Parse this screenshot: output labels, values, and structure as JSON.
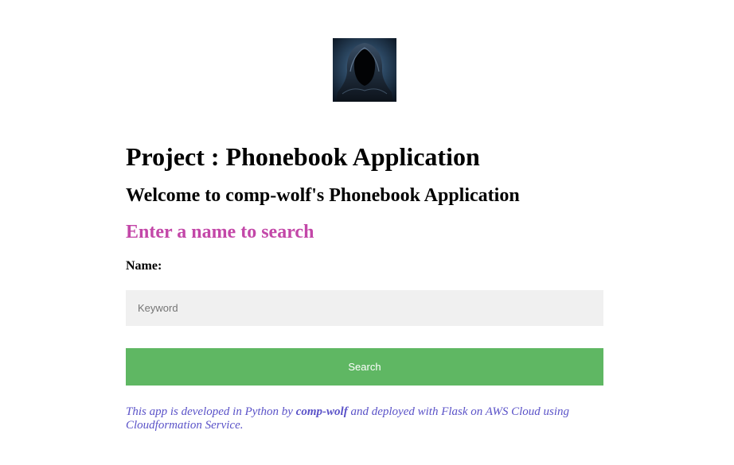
{
  "colors": {
    "heading_accent": "#c347a8",
    "button_bg": "#5fb763",
    "button_text": "#ffffff",
    "input_bg": "#f0f0f0",
    "footer_text": "#5a52c8"
  },
  "logo": {
    "icon": "hooded-figure-avatar"
  },
  "page": {
    "title": "Project : Phonebook Application",
    "welcome": "Welcome to comp-wolf's Phonebook Application",
    "search_heading": "Enter a name to search"
  },
  "form": {
    "name_label": "Name:",
    "keyword_placeholder": "Keyword",
    "keyword_value": "",
    "search_button": "Search"
  },
  "footer": {
    "text_before": "This app is developed in Python by ",
    "author": "comp-wolf",
    "text_after": " and deployed with Flask on AWS Cloud using Cloudformation Service."
  }
}
